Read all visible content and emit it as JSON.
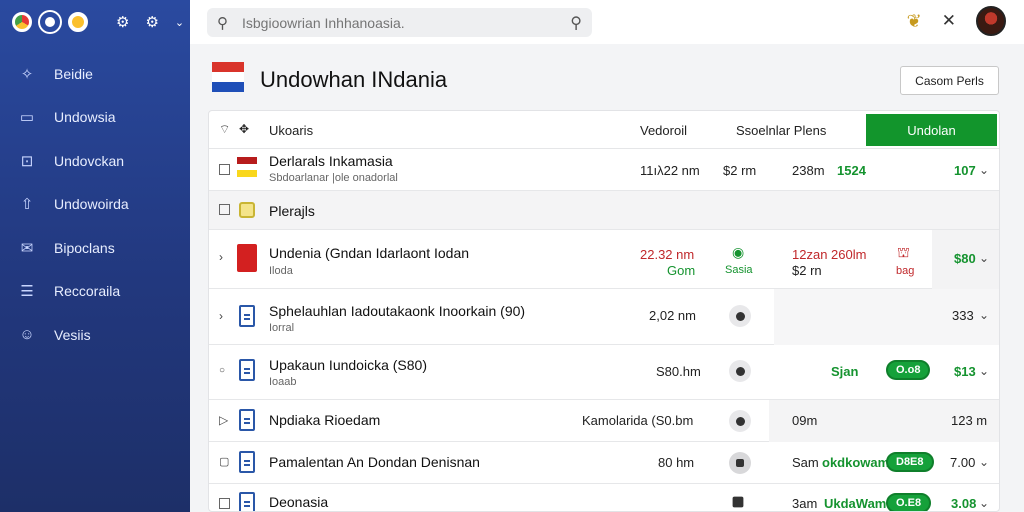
{
  "sidebar": {
    "items": [
      {
        "label": "Beidie",
        "icon": "pin-icon"
      },
      {
        "label": "Undowsia",
        "icon": "folder-icon"
      },
      {
        "label": "Undovckan",
        "icon": "download-box-icon"
      },
      {
        "label": "Undowoirda",
        "icon": "upload-icon"
      },
      {
        "label": "Bipoclans",
        "icon": "mail-icon"
      },
      {
        "label": "Reccoraila",
        "icon": "list-icon"
      },
      {
        "label": "Vesiis",
        "icon": "smile-icon"
      }
    ]
  },
  "search": {
    "placeholder": "Isbgioowrian Inhhanoasia."
  },
  "header": {
    "title": "Undowhan INdania",
    "button_label": "Casom Perls",
    "flag_colors": [
      "#d9342b",
      "#ffffff",
      "#1f4fb8"
    ]
  },
  "table": {
    "columns": {
      "name": "Ukoaris",
      "size": "Vedoroil",
      "status": "Ssoelnlar Plens",
      "action": "Undolan"
    },
    "rows": [
      {
        "name": "Derlarals Inkamasia",
        "sub": "Sbdoarlanar |ole onadorlal",
        "size": "11ıλ22 nm",
        "col2": "$2 rm",
        "col3": "238m",
        "green": "1524",
        "value": "107"
      },
      {
        "name": "Plerajls"
      },
      {
        "name": "Undenia (Gndan Idarlaont Iodan",
        "sub": "Iloda",
        "red1": "22.32 nm",
        "green1": "Gom",
        "dot1": "◉",
        "sub1": "Sasia",
        "red2": "12zan 260lm",
        "col2": "$2 rn",
        "sub2": "bag",
        "value": "$80"
      },
      {
        "name": "Sphelauhlan Iadoutakaonk Inoorkain (90)",
        "sub": "Iorral",
        "size": "2,02 nm",
        "value": "333"
      },
      {
        "name": "Upakaun Iundoicka (S80)",
        "sub": "Ioaab",
        "size": "S80.hm",
        "green": "Sjan",
        "badge": "O.o8",
        "value": "$13"
      },
      {
        "name": "Npdiaka Rioedam",
        "size": "Kamolarida (S0.bm",
        "col3": "09m",
        "value": "123 m"
      },
      {
        "name": "Pamalentan An Dondan Denisnan",
        "size": "80 hm",
        "col3": "Sam",
        "green": "okdkowam",
        "badge": "D8E8",
        "value": "7.00"
      },
      {
        "name": "Deonasia",
        "col3": "3am",
        "green": "UkdaWam",
        "badge": "O.E8",
        "value": "3.08"
      }
    ]
  }
}
